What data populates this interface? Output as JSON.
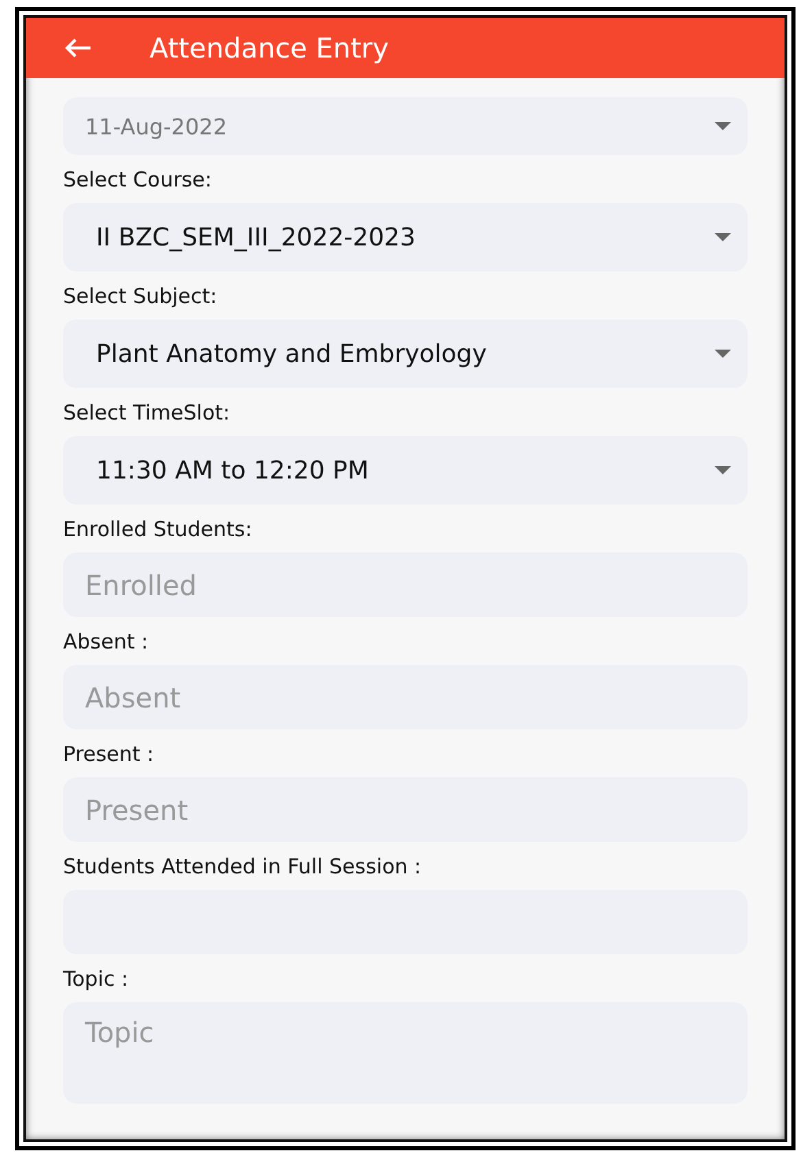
{
  "header": {
    "title": "Attendance Entry"
  },
  "fields": [
    {
      "kind": "dropdown",
      "value": "11-Aug-2022",
      "disabled": true
    },
    {
      "kind": "dropdown",
      "label": "Select Course:",
      "value": "II BZC_SEM_III_2022-2023",
      "disabled": false
    },
    {
      "kind": "dropdown",
      "label": "Select Subject:",
      "value": "Plant Anatomy and Embryology",
      "disabled": false
    },
    {
      "kind": "dropdown",
      "label": "Select TimeSlot:",
      "value": "11:30 AM to 12:20 PM",
      "disabled": false
    },
    {
      "kind": "input",
      "label": "Enrolled Students:",
      "placeholder": "Enrolled"
    },
    {
      "kind": "input",
      "label": "Absent :",
      "placeholder": "Absent"
    },
    {
      "kind": "input",
      "label": "Present :",
      "placeholder": "Present"
    },
    {
      "kind": "input",
      "label": "Students Attended in Full Session :"
    },
    {
      "kind": "textarea",
      "label": "Topic :",
      "placeholder": "Topic"
    }
  ]
}
